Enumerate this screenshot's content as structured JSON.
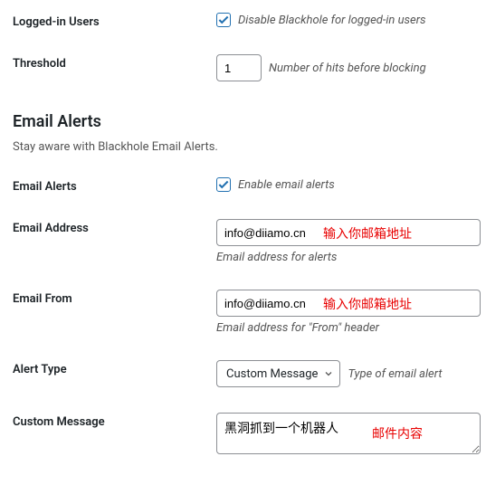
{
  "logged_in_users": {
    "label": "Logged-in Users",
    "checkbox_label": "Disable Blackhole for logged-in users",
    "checked": true
  },
  "threshold": {
    "label": "Threshold",
    "value": "1",
    "desc": "Number of hits before blocking"
  },
  "section": {
    "heading": "Email Alerts",
    "desc": "Stay aware with Blackhole Email Alerts."
  },
  "email_alerts": {
    "label": "Email Alerts",
    "checkbox_label": "Enable email alerts",
    "checked": true
  },
  "email_address": {
    "label": "Email Address",
    "value": "info@diiamo.cn",
    "helper": "Email address for alerts",
    "annotation": "输入你邮箱地址"
  },
  "email_from": {
    "label": "Email From",
    "value": "info@diiamo.cn",
    "helper": "Email address for \"From\" header",
    "annotation": "输入你邮箱地址"
  },
  "alert_type": {
    "label": "Alert Type",
    "selected": "Custom Message",
    "desc": "Type of email alert"
  },
  "custom_message": {
    "label": "Custom Message",
    "value": "黑洞抓到一个机器人",
    "annotation": "邮件内容"
  }
}
